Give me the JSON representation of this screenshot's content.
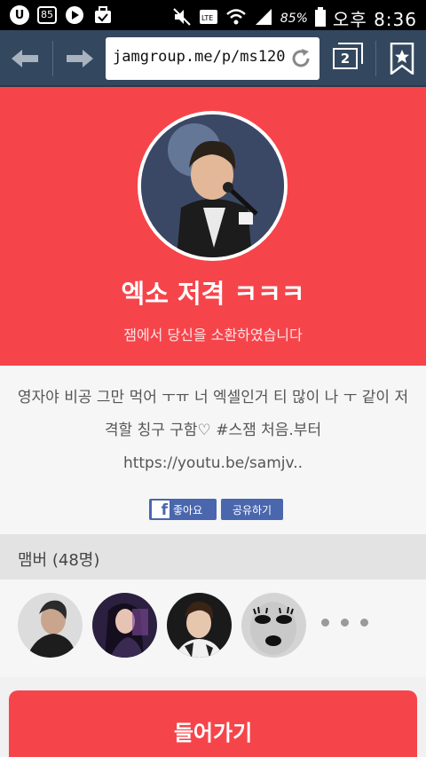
{
  "status_bar": {
    "badge": "85",
    "battery_pct": "85%",
    "time": "오후 8:36"
  },
  "browser": {
    "url": "jamgroup.me/p/ms120..",
    "tab_count": "2"
  },
  "hero": {
    "title": "엑소 저격 ㅋㅋㅋ",
    "subtitle": "잼에서 당신을 소환하였습니다"
  },
  "description": {
    "text": "영자야 비공 그만 먹어 ㅜㅠ 너 엑셀인거 티 많이 나 ㅜ 같이 저격할 칭구 구함♡ #스잼 처음.부터 https://youtu.be/samjv..",
    "like_label": "좋아요",
    "share_label": "공유하기"
  },
  "members": {
    "title": "맴버 (48명)"
  },
  "enter_button": {
    "label": "들어가기"
  },
  "colors": {
    "accent": "#f5454b",
    "toolbar": "#33475e",
    "facebook": "#4a67ad"
  }
}
